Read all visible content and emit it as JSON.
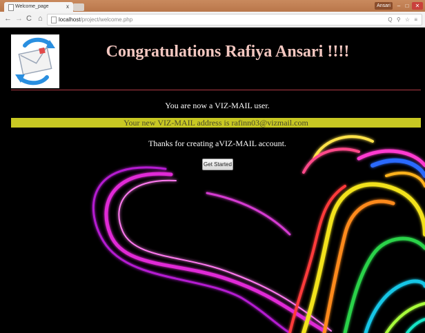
{
  "browser": {
    "tab_title": "Welcome_page",
    "tab_close": "x",
    "user": "Ansari",
    "url_host": "localhost",
    "url_path": "/project/welcome.php",
    "omnibox_icons": "Q ⚲ ☆ ≡"
  },
  "page": {
    "heading": "Congratulations Rafiya Ansari !!!!",
    "message_user": "You are now a VIZ-MAIL user.",
    "message_address": "Your new VIZ-MAIL address is rafinn03@vizmail.com",
    "message_thanks": "Thanks for creating aVIZ-MAIL account.",
    "button_label": "Get Started"
  },
  "colors": {
    "chrome_bar": "#b9764a",
    "page_bg": "#000000",
    "heading": "#f3c7c0",
    "address_bar": "#c8c823",
    "divider": "#b23a46"
  }
}
